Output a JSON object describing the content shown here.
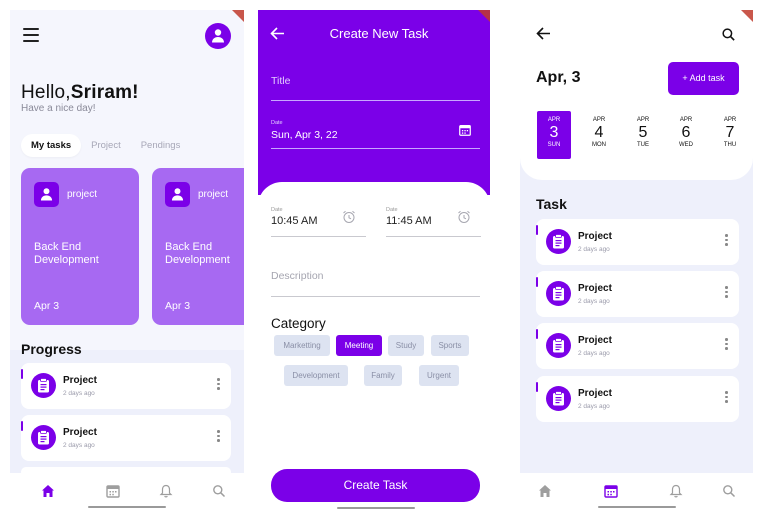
{
  "colors": {
    "accent": "#7b00e8",
    "card": "#a769f2",
    "background": "#eef0fb",
    "chip": "#dde3f1"
  },
  "screen_home": {
    "greeting_prefix": "Hello,",
    "user_name": "Sriram!",
    "subtitle": "Have a nice day!",
    "tabs": [
      "My tasks",
      "Project",
      "Pendings"
    ],
    "cards": [
      {
        "tag": "project",
        "title": "Back End Development",
        "date": "Apr 3"
      },
      {
        "tag": "project",
        "title": "Back End Development",
        "date": "Apr 3"
      }
    ],
    "progress_title": "Progress",
    "progress_items": [
      {
        "name": "Project",
        "ago": "2 days ago"
      },
      {
        "name": "Project",
        "ago": "2 days ago"
      }
    ],
    "nav_icons": [
      "home-icon",
      "calendar-icon",
      "bell-icon",
      "search-icon"
    ]
  },
  "screen_create": {
    "title": "Create New Task",
    "title_field": "Title",
    "date_label": "Date",
    "date_value": "Sun, Apr 3, 22",
    "start_time_label": "Date",
    "start_time": "10:45 AM",
    "end_time_label": "Date",
    "end_time": "11:45 AM",
    "description_placeholder": "Description",
    "category_title": "Category",
    "categories": [
      "Marketting",
      "Meeting",
      "Study",
      "Sports",
      "Development",
      "Family",
      "Urgent"
    ],
    "selected_category": "Meeting",
    "create_button": "Create Task"
  },
  "screen_calendar": {
    "date_heading": "Apr, 3",
    "add_button": "+ Add task",
    "days": [
      {
        "month": "APR",
        "day": "3",
        "weekday": "SUN"
      },
      {
        "month": "APR",
        "day": "4",
        "weekday": "MON"
      },
      {
        "month": "APR",
        "day": "5",
        "weekday": "TUE"
      },
      {
        "month": "APR",
        "day": "6",
        "weekday": "WED"
      },
      {
        "month": "APR",
        "day": "7",
        "weekday": "THU"
      }
    ],
    "selected_day": "3",
    "task_title": "Task",
    "tasks": [
      {
        "name": "Project",
        "ago": "2 days ago"
      },
      {
        "name": "Project",
        "ago": "2 days ago"
      },
      {
        "name": "Project",
        "ago": "2 days ago"
      },
      {
        "name": "Project",
        "ago": "2 days ago"
      }
    ]
  }
}
